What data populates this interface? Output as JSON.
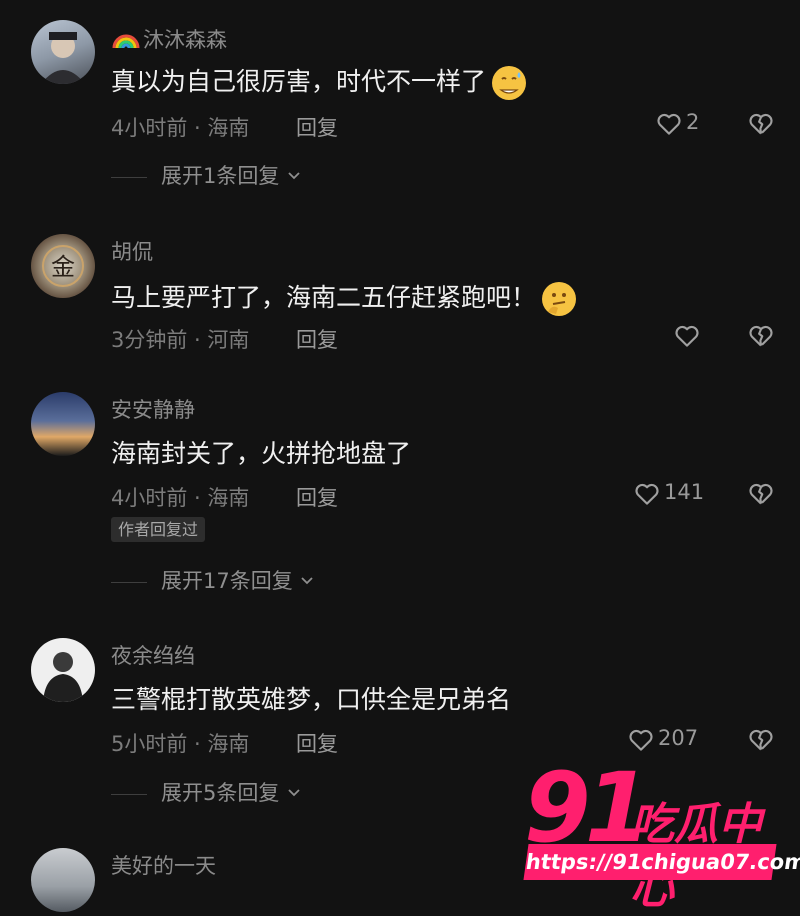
{
  "comments": [
    {
      "username": "沐沐森森",
      "text": "真以为自己很厉害，时代不一样了",
      "meta": "4小时前 · 海南",
      "reply_label": "回复",
      "likes": "2",
      "expand_label": "展开1条回复"
    },
    {
      "username": "胡侃",
      "text": "马上要严打了，海南二五仔赶紧跑吧！",
      "meta": "3分钟前 · 河南",
      "reply_label": "回复",
      "likes": ""
    },
    {
      "username": "安安静静",
      "text": "海南封关了，火拼抢地盘了",
      "meta": "4小时前 · 海南",
      "reply_label": "回复",
      "likes": "141",
      "badge": "作者回复过",
      "expand_label": "展开17条回复"
    },
    {
      "username": "夜余绉绉",
      "text": "三警棍打散英雄梦，口供全是兄弟名",
      "meta": "5小时前 · 海南",
      "reply_label": "回复",
      "likes": "207",
      "expand_label": "展开5条回复"
    },
    {
      "username": "美好的一天"
    }
  ],
  "watermark": {
    "number": "91",
    "brand": "吃瓜中心",
    "url": "https://91chigua07.com"
  },
  "colors": {
    "background": "#121212",
    "watermark": "#ff1f6e"
  }
}
